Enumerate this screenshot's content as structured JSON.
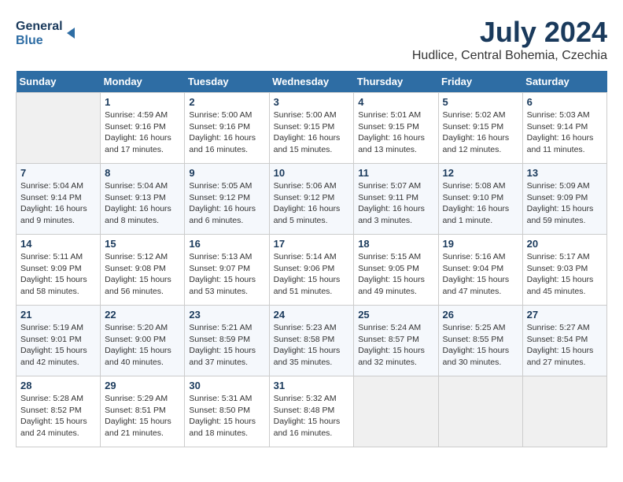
{
  "header": {
    "logo_line1": "General",
    "logo_line2": "Blue",
    "month": "July 2024",
    "location": "Hudlice, Central Bohemia, Czechia"
  },
  "days_of_week": [
    "Sunday",
    "Monday",
    "Tuesday",
    "Wednesday",
    "Thursday",
    "Friday",
    "Saturday"
  ],
  "weeks": [
    [
      {
        "day": "",
        "info": ""
      },
      {
        "day": "1",
        "info": "Sunrise: 4:59 AM\nSunset: 9:16 PM\nDaylight: 16 hours\nand 17 minutes."
      },
      {
        "day": "2",
        "info": "Sunrise: 5:00 AM\nSunset: 9:16 PM\nDaylight: 16 hours\nand 16 minutes."
      },
      {
        "day": "3",
        "info": "Sunrise: 5:00 AM\nSunset: 9:15 PM\nDaylight: 16 hours\nand 15 minutes."
      },
      {
        "day": "4",
        "info": "Sunrise: 5:01 AM\nSunset: 9:15 PM\nDaylight: 16 hours\nand 13 minutes."
      },
      {
        "day": "5",
        "info": "Sunrise: 5:02 AM\nSunset: 9:15 PM\nDaylight: 16 hours\nand 12 minutes."
      },
      {
        "day": "6",
        "info": "Sunrise: 5:03 AM\nSunset: 9:14 PM\nDaylight: 16 hours\nand 11 minutes."
      }
    ],
    [
      {
        "day": "7",
        "info": "Sunrise: 5:04 AM\nSunset: 9:14 PM\nDaylight: 16 hours\nand 9 minutes."
      },
      {
        "day": "8",
        "info": "Sunrise: 5:04 AM\nSunset: 9:13 PM\nDaylight: 16 hours\nand 8 minutes."
      },
      {
        "day": "9",
        "info": "Sunrise: 5:05 AM\nSunset: 9:12 PM\nDaylight: 16 hours\nand 6 minutes."
      },
      {
        "day": "10",
        "info": "Sunrise: 5:06 AM\nSunset: 9:12 PM\nDaylight: 16 hours\nand 5 minutes."
      },
      {
        "day": "11",
        "info": "Sunrise: 5:07 AM\nSunset: 9:11 PM\nDaylight: 16 hours\nand 3 minutes."
      },
      {
        "day": "12",
        "info": "Sunrise: 5:08 AM\nSunset: 9:10 PM\nDaylight: 16 hours\nand 1 minute."
      },
      {
        "day": "13",
        "info": "Sunrise: 5:09 AM\nSunset: 9:09 PM\nDaylight: 15 hours\nand 59 minutes."
      }
    ],
    [
      {
        "day": "14",
        "info": "Sunrise: 5:11 AM\nSunset: 9:09 PM\nDaylight: 15 hours\nand 58 minutes."
      },
      {
        "day": "15",
        "info": "Sunrise: 5:12 AM\nSunset: 9:08 PM\nDaylight: 15 hours\nand 56 minutes."
      },
      {
        "day": "16",
        "info": "Sunrise: 5:13 AM\nSunset: 9:07 PM\nDaylight: 15 hours\nand 53 minutes."
      },
      {
        "day": "17",
        "info": "Sunrise: 5:14 AM\nSunset: 9:06 PM\nDaylight: 15 hours\nand 51 minutes."
      },
      {
        "day": "18",
        "info": "Sunrise: 5:15 AM\nSunset: 9:05 PM\nDaylight: 15 hours\nand 49 minutes."
      },
      {
        "day": "19",
        "info": "Sunrise: 5:16 AM\nSunset: 9:04 PM\nDaylight: 15 hours\nand 47 minutes."
      },
      {
        "day": "20",
        "info": "Sunrise: 5:17 AM\nSunset: 9:03 PM\nDaylight: 15 hours\nand 45 minutes."
      }
    ],
    [
      {
        "day": "21",
        "info": "Sunrise: 5:19 AM\nSunset: 9:01 PM\nDaylight: 15 hours\nand 42 minutes."
      },
      {
        "day": "22",
        "info": "Sunrise: 5:20 AM\nSunset: 9:00 PM\nDaylight: 15 hours\nand 40 minutes."
      },
      {
        "day": "23",
        "info": "Sunrise: 5:21 AM\nSunset: 8:59 PM\nDaylight: 15 hours\nand 37 minutes."
      },
      {
        "day": "24",
        "info": "Sunrise: 5:23 AM\nSunset: 8:58 PM\nDaylight: 15 hours\nand 35 minutes."
      },
      {
        "day": "25",
        "info": "Sunrise: 5:24 AM\nSunset: 8:57 PM\nDaylight: 15 hours\nand 32 minutes."
      },
      {
        "day": "26",
        "info": "Sunrise: 5:25 AM\nSunset: 8:55 PM\nDaylight: 15 hours\nand 30 minutes."
      },
      {
        "day": "27",
        "info": "Sunrise: 5:27 AM\nSunset: 8:54 PM\nDaylight: 15 hours\nand 27 minutes."
      }
    ],
    [
      {
        "day": "28",
        "info": "Sunrise: 5:28 AM\nSunset: 8:52 PM\nDaylight: 15 hours\nand 24 minutes."
      },
      {
        "day": "29",
        "info": "Sunrise: 5:29 AM\nSunset: 8:51 PM\nDaylight: 15 hours\nand 21 minutes."
      },
      {
        "day": "30",
        "info": "Sunrise: 5:31 AM\nSunset: 8:50 PM\nDaylight: 15 hours\nand 18 minutes."
      },
      {
        "day": "31",
        "info": "Sunrise: 5:32 AM\nSunset: 8:48 PM\nDaylight: 15 hours\nand 16 minutes."
      },
      {
        "day": "",
        "info": ""
      },
      {
        "day": "",
        "info": ""
      },
      {
        "day": "",
        "info": ""
      }
    ]
  ]
}
